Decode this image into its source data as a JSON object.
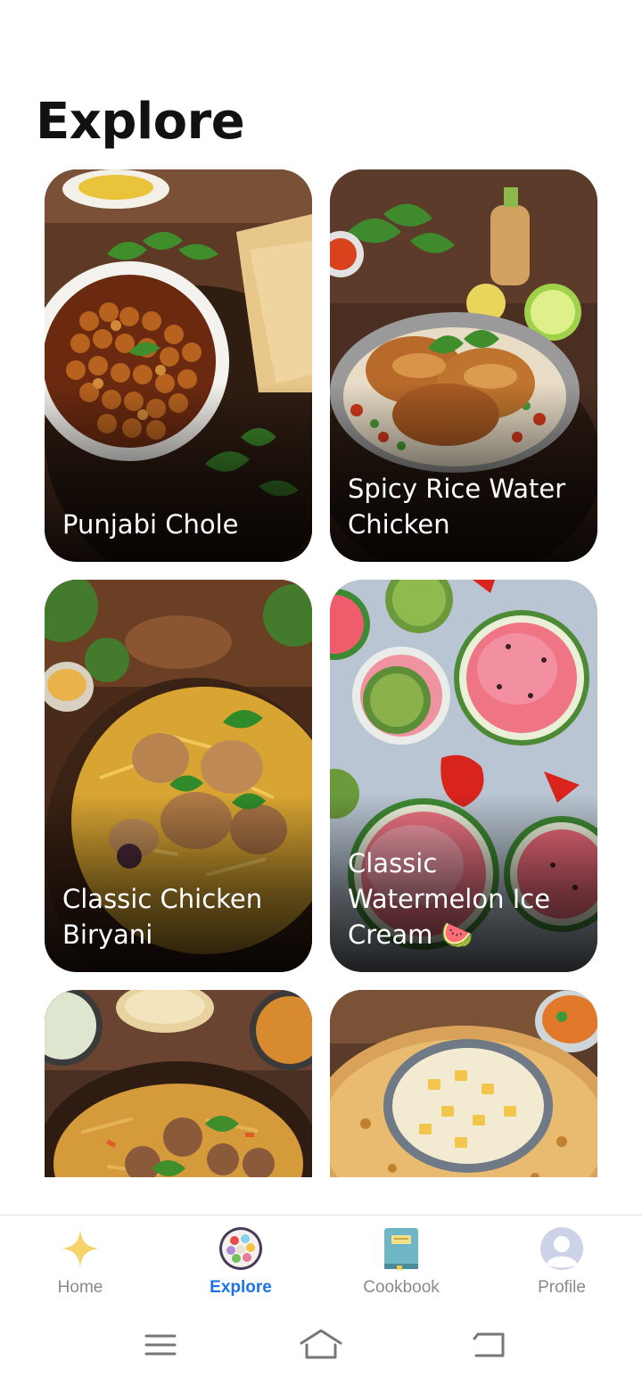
{
  "page": {
    "title": "Explore"
  },
  "recipes": [
    {
      "title": "Punjabi Chole"
    },
    {
      "title": "Spicy Rice Water Chicken"
    },
    {
      "title": "Classic Chicken Biryani"
    },
    {
      "title": "Classic Watermelon Ice Cream 🍉"
    },
    {
      "title": ""
    },
    {
      "title": ""
    }
  ],
  "nav": {
    "home": {
      "label": "Home",
      "icon": "sparkle-icon"
    },
    "explore": {
      "label": "Explore",
      "icon": "food-plate-icon"
    },
    "cookbook": {
      "label": "Cookbook",
      "icon": "cookbook-icon"
    },
    "profile": {
      "label": "Profile",
      "icon": "profile-icon"
    },
    "active": "explore"
  },
  "colors": {
    "active": "#1a73e8",
    "inactive": "#8a8a8a",
    "sparkle": "#f7d46a"
  }
}
